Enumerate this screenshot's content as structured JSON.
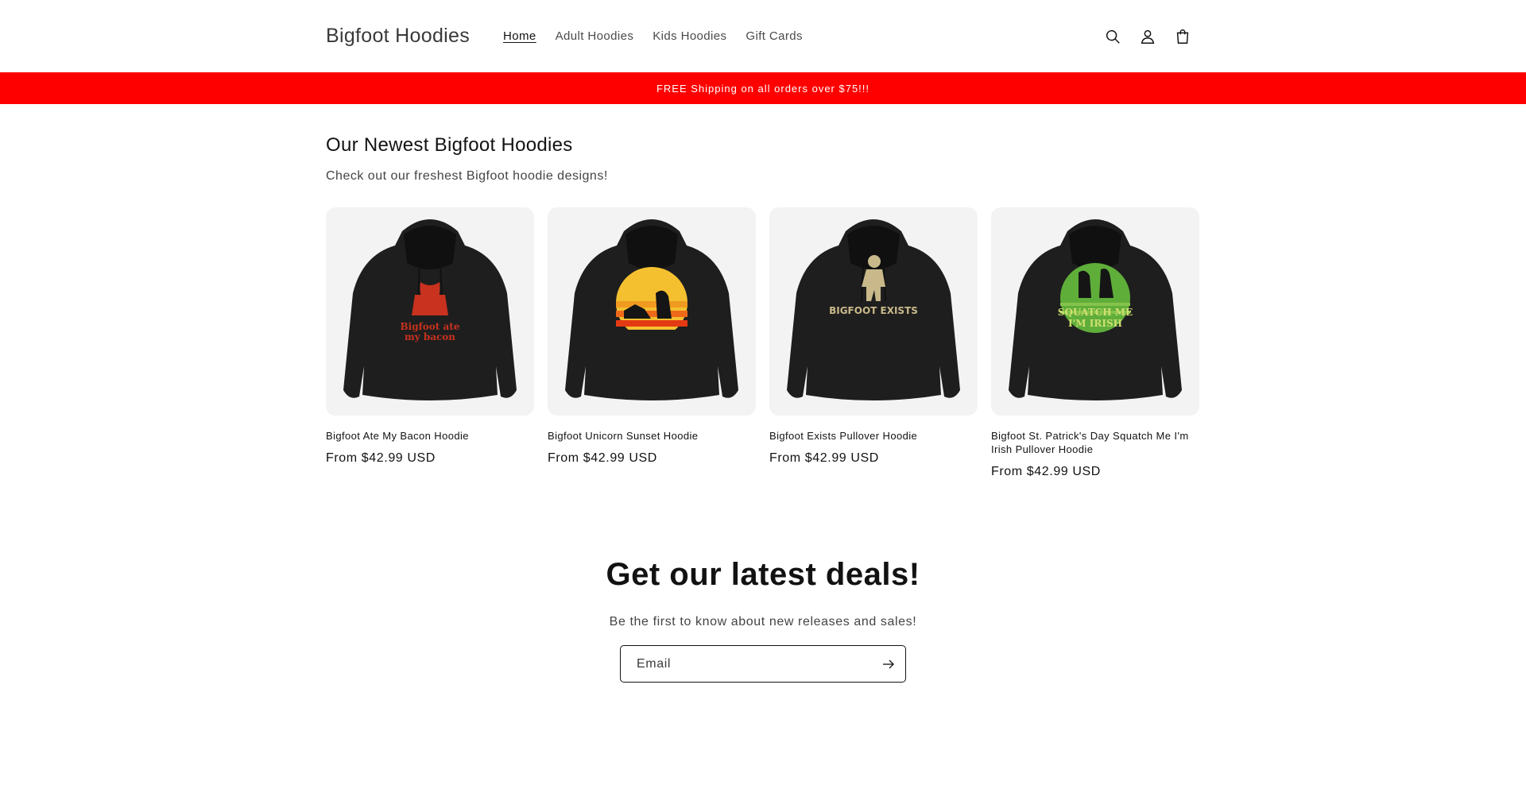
{
  "header": {
    "logo": "Bigfoot Hoodies",
    "nav": [
      {
        "label": "Home",
        "active": true
      },
      {
        "label": "Adult Hoodies",
        "active": false
      },
      {
        "label": "Kids Hoodies",
        "active": false
      },
      {
        "label": "Gift Cards",
        "active": false
      }
    ],
    "icons": [
      "search-icon",
      "account-icon",
      "cart-icon"
    ]
  },
  "announcement": {
    "text": "FREE Shipping on all orders over $75!!!",
    "background": "#ff0000"
  },
  "collection": {
    "title": "Our Newest Bigfoot Hoodies",
    "subtitle": "Check out our freshest Bigfoot hoodie designs!",
    "products": [
      {
        "title": "Bigfoot Ate My Bacon Hoodie",
        "price": "From $42.99 USD",
        "print_text": [
          "Bigfoot ate",
          "my bacon"
        ],
        "print_color": "#c8321e"
      },
      {
        "title": "Bigfoot Unicorn Sunset Hoodie",
        "price": "From $42.99 USD",
        "print_text": [],
        "print_color": "#f0a020"
      },
      {
        "title": "Bigfoot Exists Pullover Hoodie",
        "price": "From $42.99 USD",
        "print_text": [
          "BIGFOOT EXISTS"
        ],
        "print_color": "#c9b98a"
      },
      {
        "title": "Bigfoot St. Patrick's Day Squatch Me I'm Irish Pullover Hoodie",
        "price": "From $42.99 USD",
        "print_text": [
          "SQUATCH ME",
          "I'M IRISH"
        ],
        "print_color": "#5fae3a"
      }
    ]
  },
  "newsletter": {
    "title": "Get our latest deals!",
    "text": "Be the first to know about new releases and sales!",
    "email_placeholder": "Email"
  }
}
